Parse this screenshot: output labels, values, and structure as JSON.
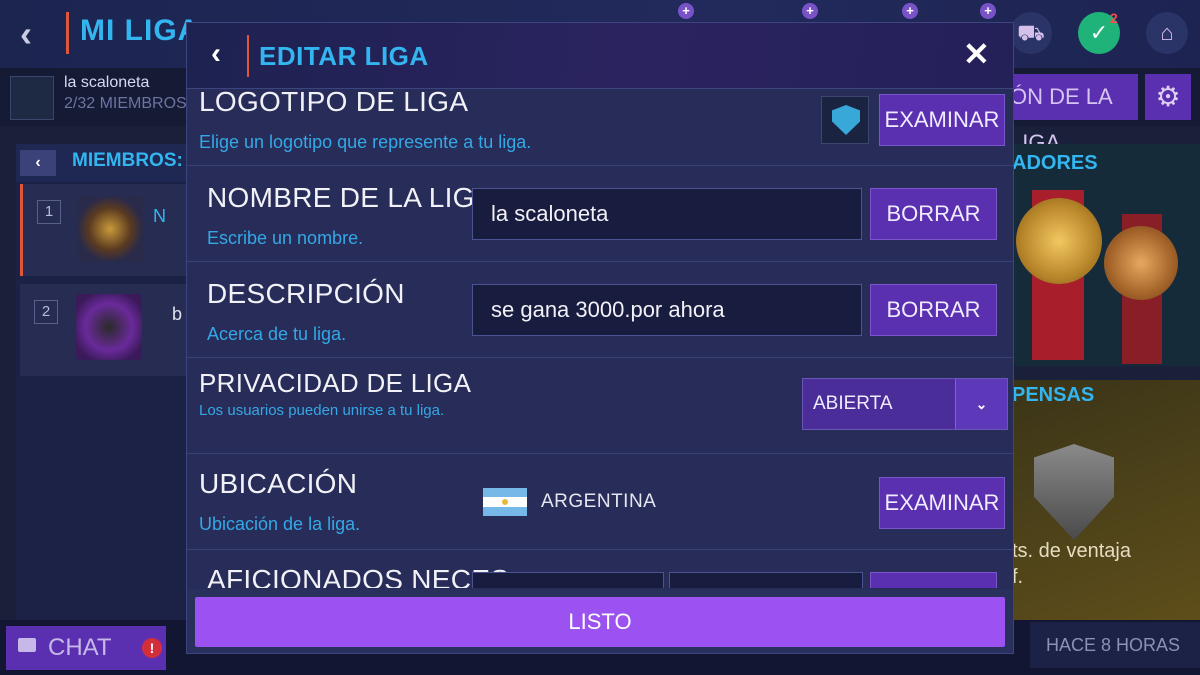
{
  "background": {
    "title": "MI LIGA",
    "league_name": "la scaloneta",
    "league_members": "2/32 MIEMBROS",
    "right_button": "ÓN DE LA LIGA",
    "members_title": "MIEMBROS:",
    "right_panel_title": "ADORES",
    "right_panel2_title": "PENSAS",
    "ventaja_text": "ts. de ventaja",
    "ventaja_text2": "f.",
    "tasks_badge": "2",
    "rows": [
      {
        "rank": "1",
        "name": "N"
      },
      {
        "rank": "2",
        "name": "b"
      }
    ],
    "chat_label": "CHAT",
    "chat_alert": "!",
    "hace": "HACE 8 HORAS"
  },
  "modal": {
    "title": "EDITAR LIGA",
    "close_label": "✕",
    "back_label": "‹",
    "logo": {
      "title": "LOGOTIPO DE LIGA",
      "subtitle": "Elige un logotipo que represente a tu liga.",
      "button": "EXAMINAR"
    },
    "name": {
      "title": "NOMBRE DE LA LIGA",
      "subtitle": "Escribe un nombre.",
      "value": "la scaloneta",
      "button": "BORRAR"
    },
    "description": {
      "title": "DESCRIPCIÓN",
      "subtitle": "Acerca de tu liga.",
      "value": "se gana 3000.por ahora",
      "button": "BORRAR"
    },
    "privacy": {
      "title": "PRIVACIDAD DE LIGA",
      "subtitle": "Los usuarios pueden unirse a tu liga.",
      "value": "ABIERTA"
    },
    "location": {
      "title": "UBICACIÓN",
      "subtitle": "Ubicación de la liga.",
      "country": "ARGENTINA",
      "button": "EXAMINAR"
    },
    "fans": {
      "title": "AFICIONADOS NECES"
    },
    "done_button": "LISTO"
  },
  "colors": {
    "accent_blue": "#33b5f0",
    "button_purple": "#5a2fb0",
    "done_purple": "#9b52f0",
    "divider_orange": "#e0563a"
  }
}
